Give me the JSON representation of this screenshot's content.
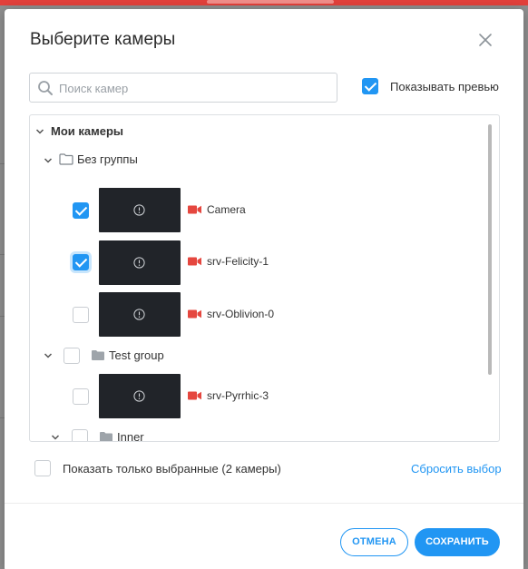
{
  "dialog": {
    "title": "Выберите камеры",
    "close_icon": "close-icon"
  },
  "search": {
    "placeholder": "Поиск камер",
    "value": ""
  },
  "show_preview": {
    "label": "Показывать превью",
    "checked": true
  },
  "tree": {
    "root_label": "Мои камеры",
    "groups": [
      {
        "label": "Без группы",
        "icon": "folder-outline-icon",
        "cameras": [
          {
            "name": "Camera",
            "checked": true
          },
          {
            "name": "srv-Felicity-1",
            "checked": true
          },
          {
            "name": "srv-Oblivion-0",
            "checked": false
          }
        ]
      },
      {
        "label": "Test group",
        "icon": "folder-icon",
        "checked": false,
        "cameras": [
          {
            "name": "srv-Pyrrhic-3",
            "checked": false
          }
        ],
        "subgroups": [
          {
            "label": "Inner",
            "icon": "folder-icon",
            "checked": false
          }
        ]
      }
    ]
  },
  "footer": {
    "show_only_selected_label": "Показать только выбранные (2 камеры)",
    "show_only_selected_checked": false,
    "reset_label": "Сбросить выбор",
    "cancel_label": "ОТМЕНА",
    "save_label": "СОХРАНИТЬ"
  },
  "colors": {
    "accent": "#2196f3",
    "camera_icon": "#e5473f",
    "thumbnail_bg": "#212429"
  }
}
